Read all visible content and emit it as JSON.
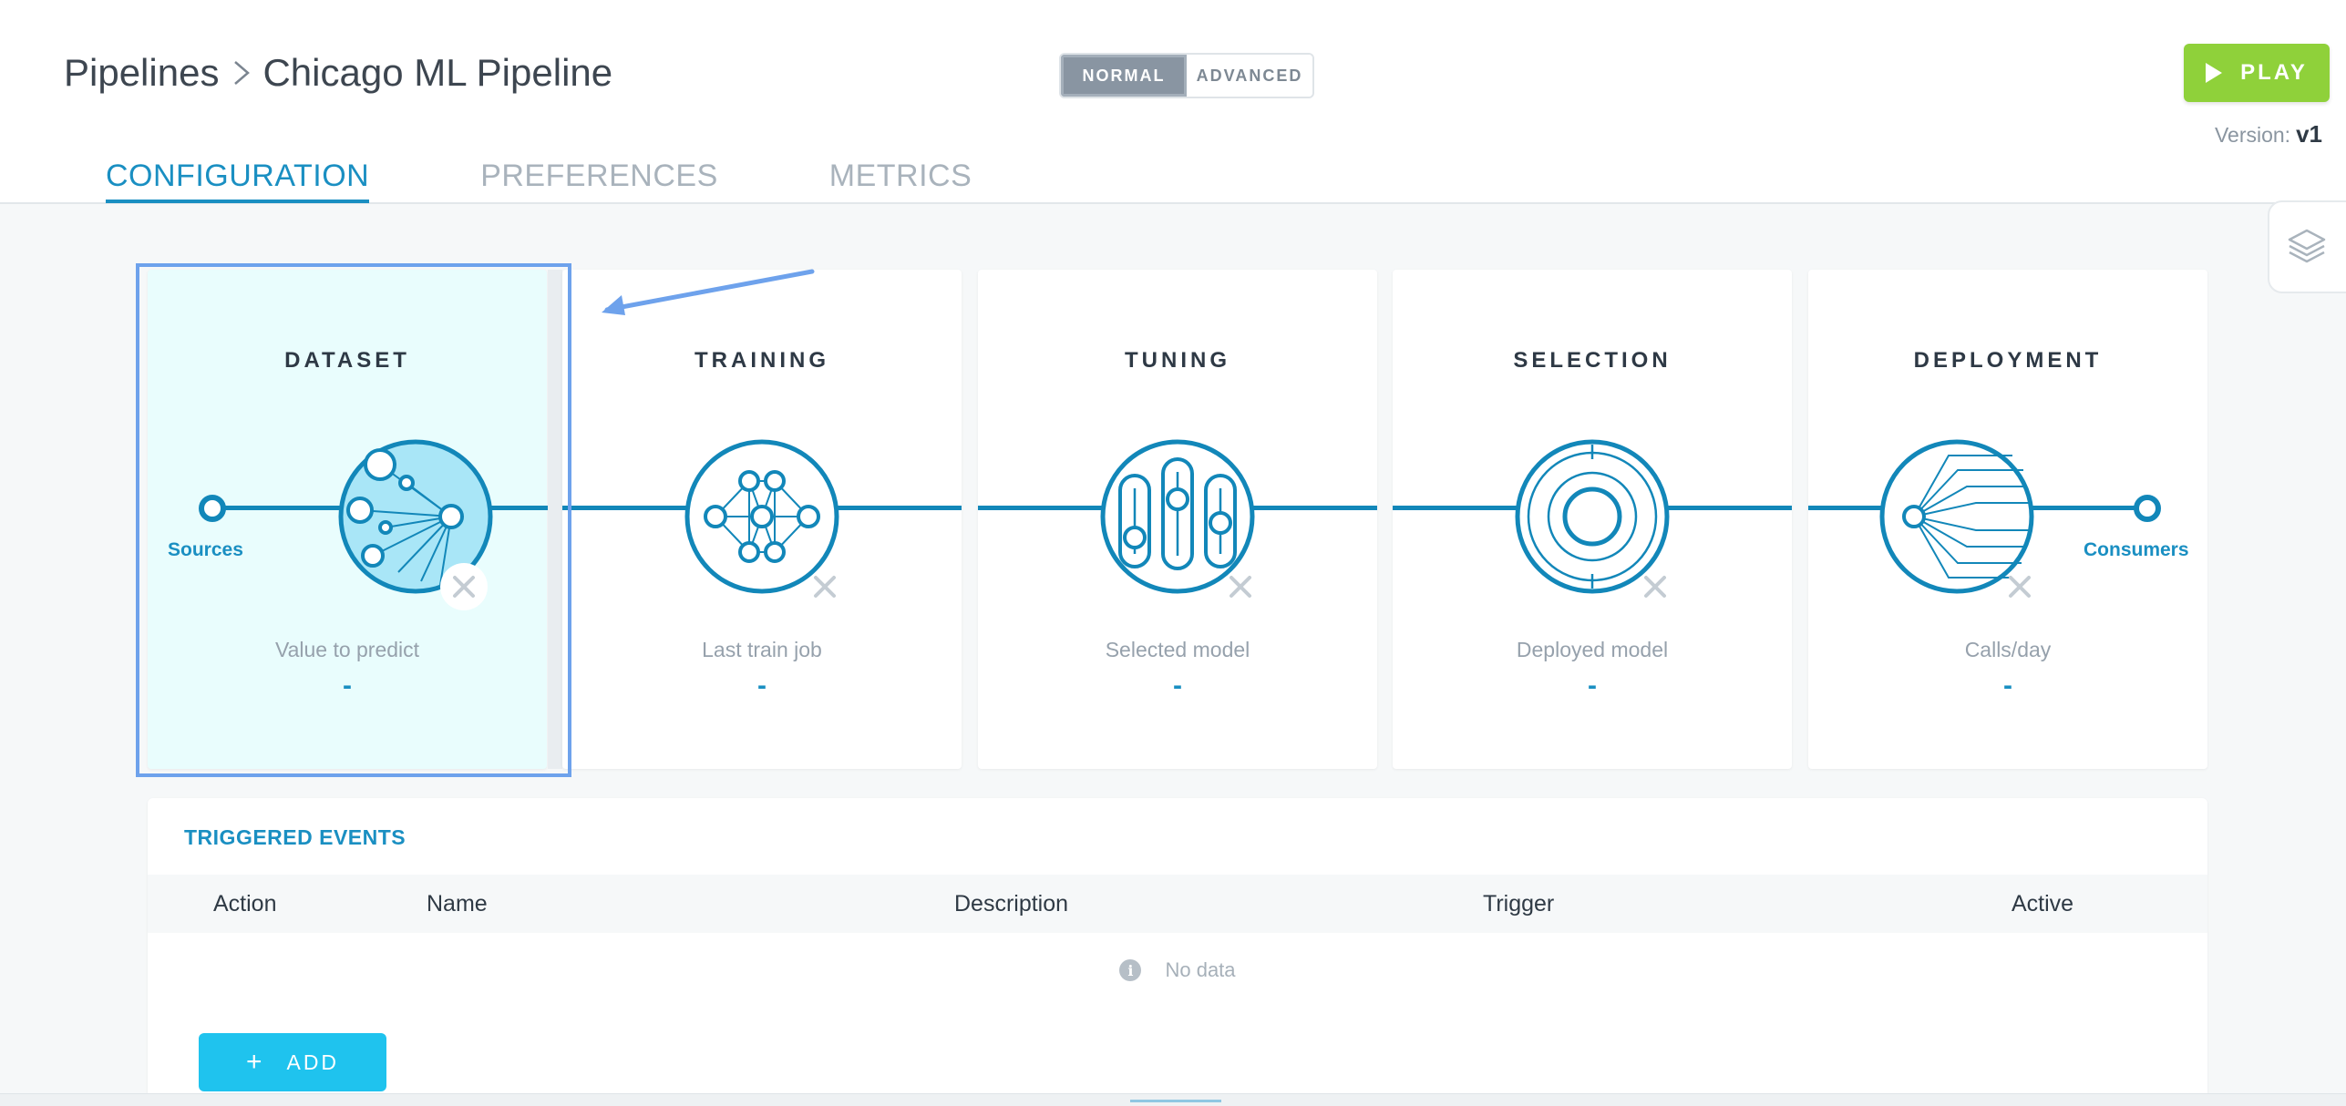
{
  "header": {
    "breadcrumb_root": "Pipelines",
    "breadcrumb_current": "Chicago ML Pipeline",
    "mode_normal": "NORMAL",
    "mode_advanced": "ADVANCED",
    "play_label": "PLAY",
    "version_label": "Version:",
    "version_value": "v1"
  },
  "tabs": [
    "CONFIGURATION",
    "PREFERENCES",
    "METRICS"
  ],
  "pipeline": {
    "sources_label": "Sources",
    "consumers_label": "Consumers",
    "cards": [
      {
        "title": "DATASET",
        "label": "Value to predict",
        "value": "-",
        "icon": "dataset-icon"
      },
      {
        "title": "TRAINING",
        "label": "Last train job",
        "value": "-",
        "icon": "neural-network-icon"
      },
      {
        "title": "TUNING",
        "label": "Selected model",
        "value": "-",
        "icon": "sliders-icon"
      },
      {
        "title": "SELECTION",
        "label": "Deployed model",
        "value": "-",
        "icon": "target-icon"
      },
      {
        "title": "DEPLOYMENT",
        "label": "Calls/day",
        "value": "-",
        "icon": "fan-out-icon"
      }
    ]
  },
  "events": {
    "title": "TRIGGERED EVENTS",
    "columns": [
      "Action",
      "Name",
      "Description",
      "Trigger",
      "Active"
    ],
    "empty_text": "No data",
    "add_label": "ADD",
    "add_icon": "plus-icon"
  },
  "colors": {
    "accent": "#1287b9",
    "play": "#8fd13a",
    "add": "#1fc3ee",
    "highlight": "#6ea2ec"
  }
}
